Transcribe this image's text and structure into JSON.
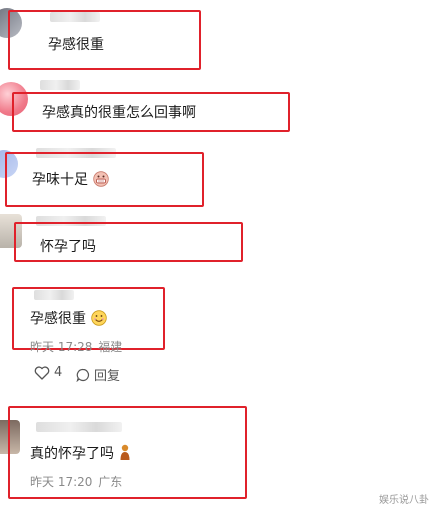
{
  "comments": [
    {
      "text": "孕感很重"
    },
    {
      "text": "孕感真的很重怎么回事啊"
    },
    {
      "text": "孕味十足",
      "emoji": "grimace-emoji"
    },
    {
      "text": "怀孕了吗"
    },
    {
      "text": "孕感很重",
      "emoji": "smile-emoji",
      "time": "昨天 17:28",
      "location": "福建",
      "likes": "4",
      "reply_label": "回复"
    },
    {
      "text": "真的怀孕了吗",
      "emoji": "gesture-emoji",
      "time": "昨天 17:20",
      "location": "广东"
    }
  ],
  "watermark": "娱乐说八卦",
  "colors": {
    "highlight": "#e0212b",
    "meta": "#8a8a8a"
  }
}
